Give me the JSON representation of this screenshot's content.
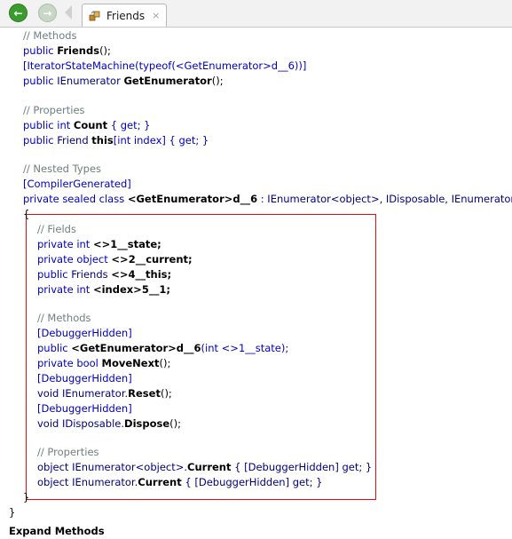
{
  "tab": {
    "title": "Friends",
    "close": "×"
  },
  "nav": {
    "back": "←",
    "forward": "→"
  },
  "code": {
    "c_methods": "// Methods",
    "l_ctor_k": "public ",
    "l_ctor_name": "Friends",
    "l_ctor_tail": "();",
    "l_attr_open": "[IteratorStateMachine(",
    "l_attr_typeof": "typeof",
    "l_attr_arg": "(<GetEnumerator>d__6))]",
    "l_ge_k": "public ",
    "l_ge_t": "IEnumerator ",
    "l_ge_name": "GetEnumerator",
    "l_ge_tail": "();",
    "c_props": "// Properties",
    "l_cnt_k": "public int ",
    "l_cnt_name": "Count",
    "l_cnt_tail": " { get; }",
    "l_idx_k": "public ",
    "l_idx_t": "Friend ",
    "l_idx_name": "this",
    "l_idx_mid": "[int index]",
    "l_idx_tail": " { get; }",
    "c_nested": "// Nested Types",
    "l_cg": "[CompilerGenerated]",
    "l_cls_k": "private sealed class ",
    "l_cls_name": "<GetEnumerator>d__6",
    "l_cls_tail": " : IEnumerator<object>, IDisposable, IEnumerator",
    "l_open": "{",
    "c_fields": "// Fields",
    "f1_k": "private int ",
    "f1_n": "<>1__state;",
    "f2_k": "private object ",
    "f2_n": "<>2__current;",
    "f3_k": "public ",
    "f3_t": "Friends ",
    "f3_n": "<>4__this;",
    "f4_k": "private int ",
    "f4_n": "<index>5__1;",
    "c_m2": "// Methods",
    "dh1": "[DebuggerHidden]",
    "m1_k": "public ",
    "m1_n": "<GetEnumerator>d__6",
    "m1_tail": "(int <>1__state);",
    "m2_k": "private bool ",
    "m2_n": "MoveNext",
    "m2_tail": "();",
    "dh2": "[DebuggerHidden]",
    "m3_pre": "void IEnumerator.",
    "m3_n": "Reset",
    "m3_tail": "();",
    "dh3": "[DebuggerHidden]",
    "m4_pre": "void IDisposable.",
    "m4_n": "Dispose",
    "m4_tail": "();",
    "c_p2": "// Properties",
    "p1_pre": "object IEnumerator<object>.",
    "p1_n": "Current",
    "p1_tail": " { [DebuggerHidden] get; }",
    "p2_pre": "object IEnumerator.",
    "p2_n": "Current",
    "p2_tail": " { [DebuggerHidden] get; }",
    "l_close_inner": "}",
    "l_close_outer": "}",
    "cut_line": "Expand Methods"
  }
}
